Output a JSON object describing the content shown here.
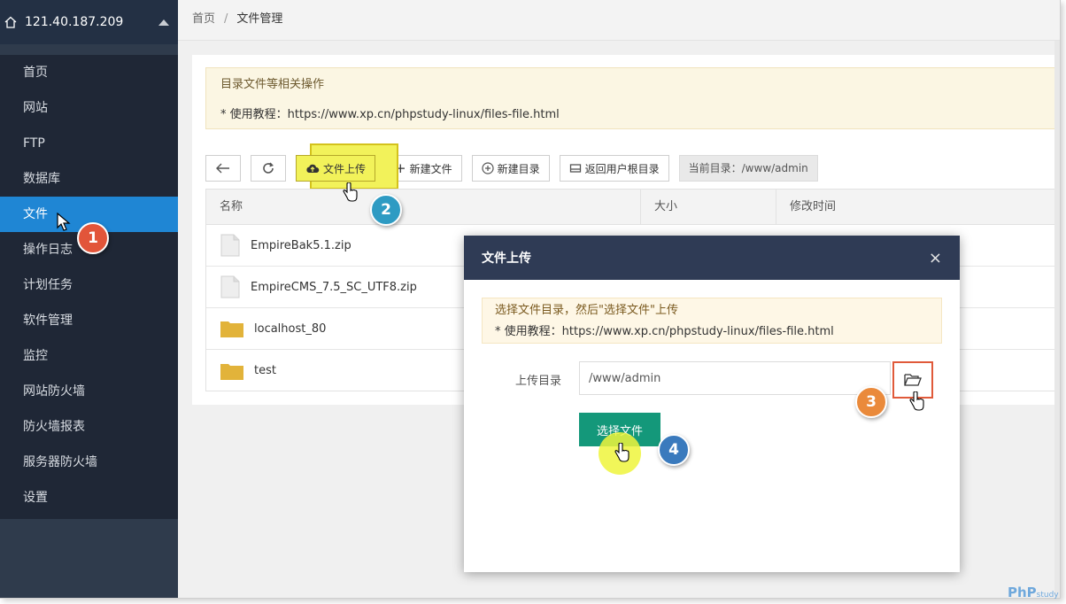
{
  "sidebar": {
    "server_ip": "121.40.187.209",
    "items": [
      {
        "label": "首页"
      },
      {
        "label": "网站"
      },
      {
        "label": "FTP"
      },
      {
        "label": "数据库"
      },
      {
        "label": "文件",
        "active": true
      },
      {
        "label": "操作日志"
      },
      {
        "label": "计划任务"
      },
      {
        "label": "软件管理"
      },
      {
        "label": "监控"
      },
      {
        "label": "网站防火墙"
      },
      {
        "label": "防火墙报表"
      },
      {
        "label": "服务器防火墙"
      },
      {
        "label": "设置"
      }
    ]
  },
  "breadcrumb": {
    "home": "首页",
    "separator": "/",
    "current": "文件管理"
  },
  "notice": {
    "line1": "目录文件等相关操作",
    "line2": "* 使用教程：https://www.xp.cn/phpstudy-linux/files-file.html"
  },
  "toolbar": {
    "upload": "文件上传",
    "new_file": "新建文件",
    "new_dir": "新建目录",
    "home_dir": "返回用户根目录",
    "current_dir": "当前目录：/www/admin"
  },
  "table": {
    "headers": [
      "名称",
      "大小",
      "修改时间"
    ],
    "rows": [
      {
        "name": "EmpireBak5.1.zip",
        "type": "file"
      },
      {
        "name": "EmpireCMS_7.5_SC_UTF8.zip",
        "type": "file"
      },
      {
        "name": "localhost_80",
        "type": "folder"
      },
      {
        "name": "test",
        "type": "folder"
      }
    ]
  },
  "modal": {
    "title": "文件上传",
    "close": "×",
    "notice1": "选择文件目录，然后\"选择文件\"上传",
    "notice2": "* 使用教程：https://www.xp.cn/phpstudy-linux/files-file.html",
    "dir_label": "上传目录",
    "dir_value": "/www/admin",
    "choose_button": "选择文件"
  },
  "steps": [
    "1",
    "2",
    "3",
    "4"
  ],
  "brand": {
    "name": "PhP",
    "sub": "study"
  },
  "colors": {
    "sidebar_bg": "#1f2736",
    "active_item": "#1f86d4",
    "modal_header": "#2f3b55",
    "primary_button": "#14987a",
    "highlight": "#f2f25a",
    "folder": "#e2b33a"
  }
}
